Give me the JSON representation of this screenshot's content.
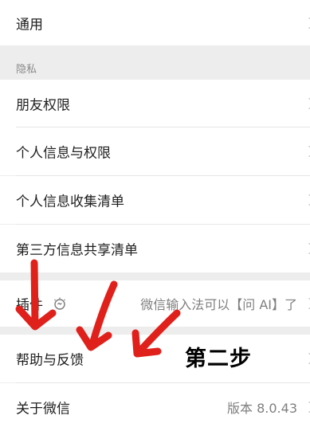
{
  "general": {
    "label": "通用"
  },
  "privacy_section": {
    "title": "隐私"
  },
  "privacy_items": [
    {
      "label": "朋友权限"
    },
    {
      "label": "个人信息与权限"
    },
    {
      "label": "个人信息收集清单"
    },
    {
      "label": "第三方信息共享清单"
    }
  ],
  "plugins": {
    "label": "插件",
    "value": "微信输入法可以【问 AI】了"
  },
  "help": {
    "label": "帮助与反馈"
  },
  "about": {
    "label": "关于微信",
    "value": "版本 8.0.43"
  },
  "annotation": {
    "text": "第二步",
    "color": "#e0201a"
  }
}
